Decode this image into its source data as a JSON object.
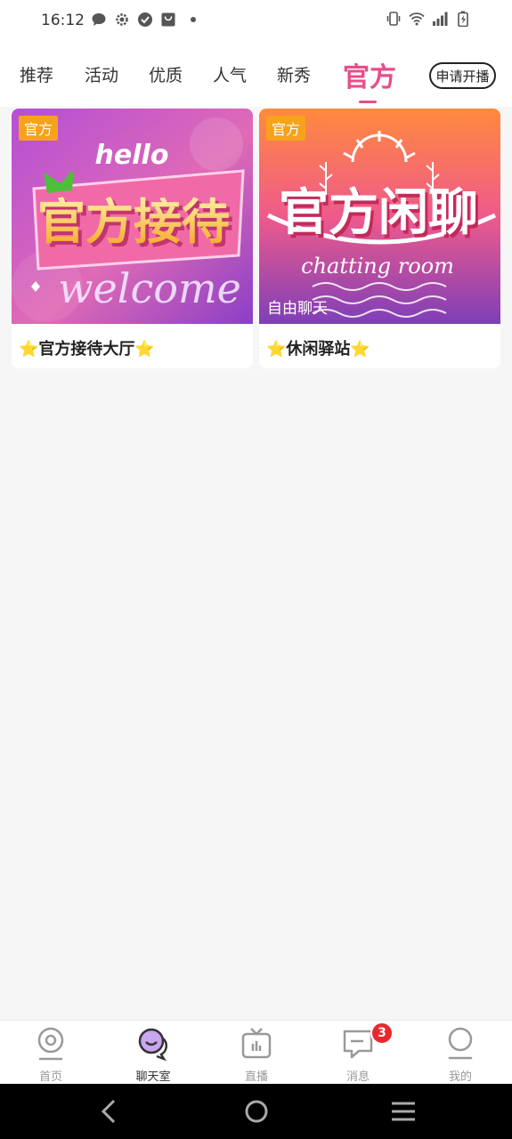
{
  "status_bar": {
    "time": "16:12",
    "left_icons": [
      "chat-bubble-icon",
      "gear-icon",
      "check-circle-icon",
      "bag-icon",
      "dot-icon"
    ],
    "right_icons": [
      "vibrate-icon",
      "wifi-icon",
      "signal-icon",
      "battery-charging-icon"
    ]
  },
  "tabs": {
    "items": [
      {
        "label": "推荐"
      },
      {
        "label": "活动"
      },
      {
        "label": "优质"
      },
      {
        "label": "人气"
      },
      {
        "label": "新秀"
      },
      {
        "label": "官方",
        "active": true
      }
    ],
    "apply_button": "申请开播"
  },
  "rooms": [
    {
      "tag": "官方",
      "banner_small": "hello",
      "banner_text": "官方接待",
      "banner_script": "welcome",
      "subtitle": "",
      "title_star_left": "⭐",
      "title": "官方接待大厅",
      "title_star_right": "⭐"
    },
    {
      "tag": "官方",
      "banner_small": "",
      "banner_text": "官方闲聊",
      "banner_script": "chatting room",
      "subtitle": "自由聊天",
      "title_star_left": "⭐",
      "title": "休闲驿站",
      "title_star_right": "⭐"
    }
  ],
  "bottom_nav": {
    "items": [
      {
        "label": "首页",
        "icon": "camera-icon"
      },
      {
        "label": "聊天室",
        "icon": "chat-room-icon",
        "active": true
      },
      {
        "label": "直播",
        "icon": "tv-icon"
      },
      {
        "label": "消息",
        "icon": "message-icon"
      },
      {
        "label": "我的",
        "icon": "profile-icon"
      }
    ],
    "message_badge": "3"
  },
  "colors": {
    "accent": "#e84d89",
    "tag": "#f7a21b",
    "badge": "#e8282e"
  }
}
